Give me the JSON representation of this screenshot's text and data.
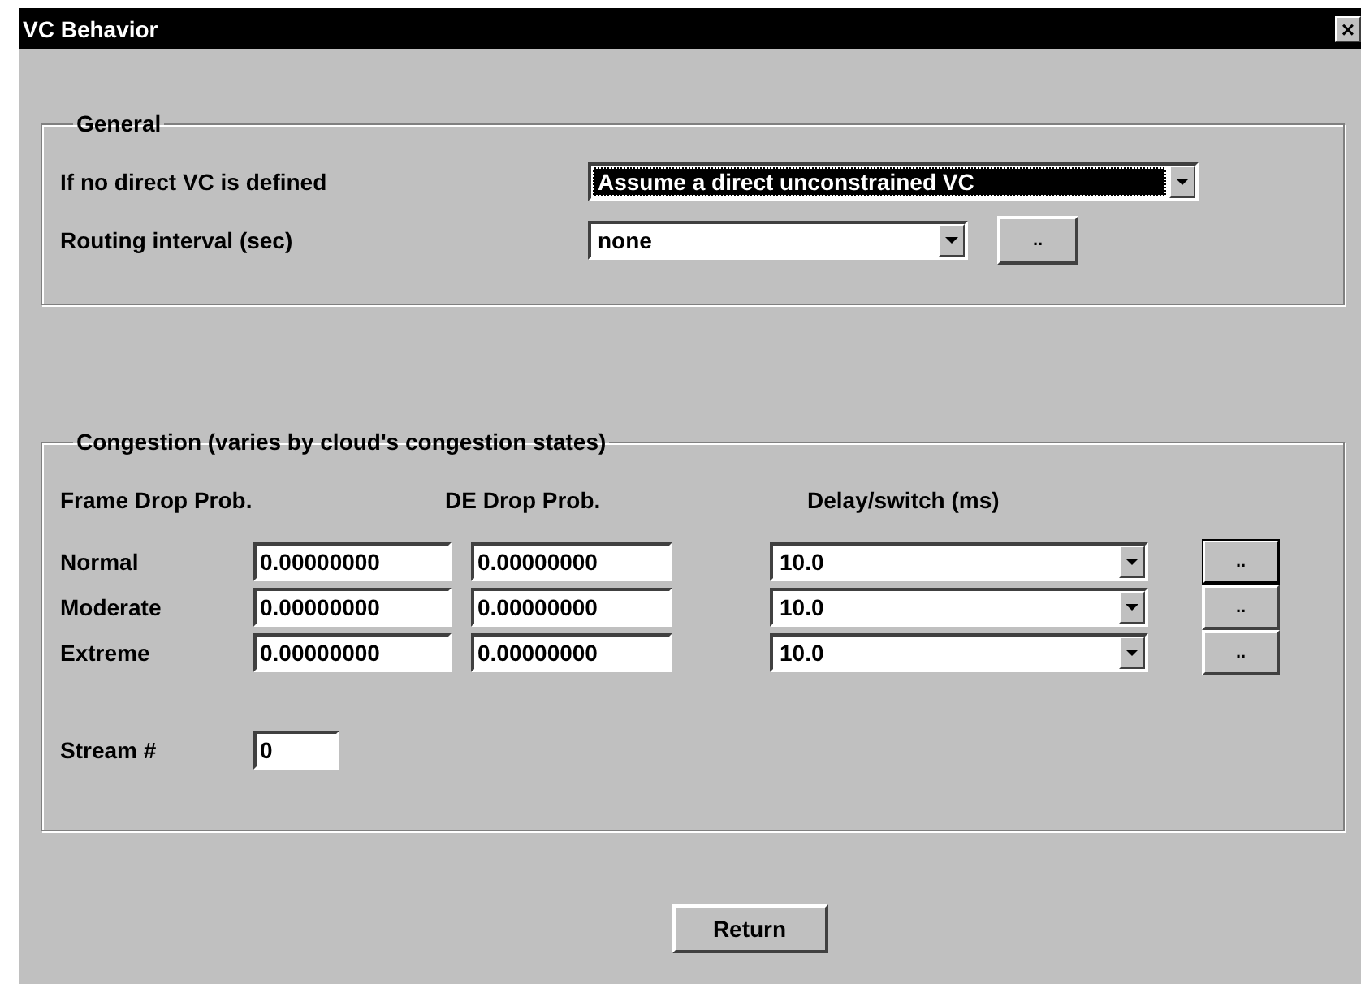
{
  "window": {
    "title": "VC Behavior",
    "close": "×"
  },
  "general": {
    "title": "General",
    "rows": [
      {
        "label": "If no direct VC is defined",
        "value": "Assume a direct unconstrained VC",
        "highlighted": true,
        "button": null
      },
      {
        "label": "Routing interval (sec)",
        "value": "none",
        "highlighted": false,
        "button": ".."
      }
    ]
  },
  "congestion": {
    "title": "Congestion (varies by cloud's congestion states)",
    "headers": [
      "Frame Drop Prob.",
      "DE Drop Prob.",
      "Delay/switch (ms)"
    ],
    "rows": [
      {
        "label": "Normal",
        "frame_drop": "0.00000000",
        "de_drop": "0.00000000",
        "delay": "10.0",
        "button": "..",
        "default": true
      },
      {
        "label": "Moderate",
        "frame_drop": "0.00000000",
        "de_drop": "0.00000000",
        "delay": "10.0",
        "button": "..",
        "default": false
      },
      {
        "label": "Extreme",
        "frame_drop": "0.00000000",
        "de_drop": "0.00000000",
        "delay": "10.0",
        "button": "..",
        "default": false
      }
    ],
    "stream": {
      "label": "Stream #",
      "value": "0"
    }
  },
  "buttons": [
    "Return"
  ]
}
